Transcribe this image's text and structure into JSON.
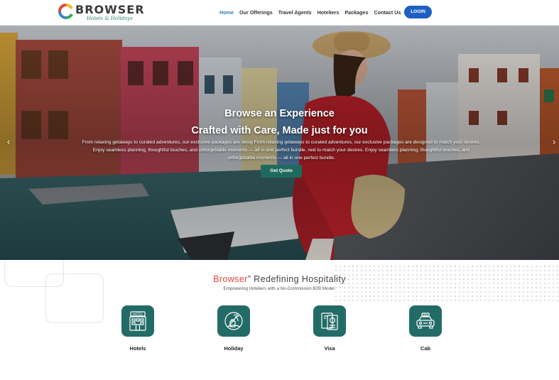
{
  "header": {
    "logo": {
      "name": "BROWSER",
      "tagline": "Hotels & Holidays"
    },
    "nav": [
      {
        "label": "Home",
        "active": true
      },
      {
        "label": "Our Offerings",
        "active": false
      },
      {
        "label": "Travel Agents",
        "active": false
      },
      {
        "label": "Hoteliers",
        "active": false
      },
      {
        "label": "Packages",
        "active": false
      },
      {
        "label": "Contact Us",
        "active": false
      }
    ],
    "login_label": "LOGIN"
  },
  "hero": {
    "title_line1": "Browse an Experience",
    "title_line2": "Crafted with Care, Made just for you",
    "description": "From relaxing getaways to curated adventures, our exclusive packages are desig From relaxing getaways to curated adventures, our exclusive packages are designed to match your desires. Enjoy seamless planning, thoughtful touches, and unforgettable moments — all in one perfect bundle. ned to match your desires. Enjoy seamless planning, thoughtful touches, and unforgettable moments — all in one perfect bundle.",
    "cta_label": "Get Quote",
    "prev_icon": "chevron-left-icon",
    "next_icon": "chevron-right-icon"
  },
  "intro": {
    "brand": "Browser",
    "title_rest": "” Redefining Hospitality",
    "subtitle": "Empowering Hoteliers with a No-Commission B2B Model."
  },
  "services": [
    {
      "label": "Hotels",
      "icon": "hotel-icon",
      "sign": "HOTEL"
    },
    {
      "label": "Holiday",
      "icon": "holiday-icon"
    },
    {
      "label": "Visa",
      "icon": "visa-icon"
    },
    {
      "label": "Cab",
      "icon": "cab-icon",
      "sign": "TAXI"
    }
  ],
  "colors": {
    "brand_red": "#e2453a",
    "login_blue": "#1e5fc4",
    "teal": "#236b67",
    "nav_active": "#2f7fb5"
  }
}
